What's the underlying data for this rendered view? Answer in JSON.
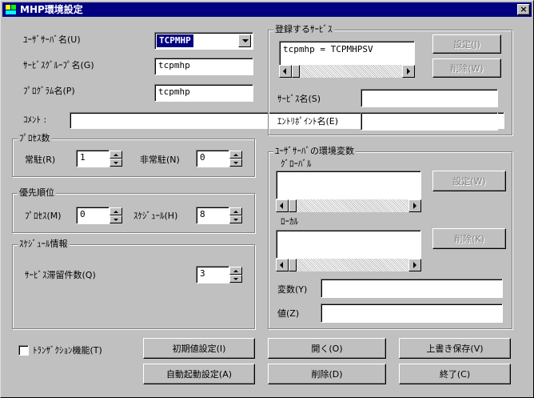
{
  "window": {
    "title": "MHP環境設定",
    "close_glyph": "×"
  },
  "left": {
    "user_server_name_label": "ﾕｰｻﾞｻｰﾊﾞ名(U)",
    "user_server_name_value": "TCPMHP",
    "service_group_name_label": "ｻｰﾋﾞｽｸﾞﾙｰﾌﾟ名(G)",
    "service_group_name_value": "tcpmhp",
    "program_name_label": "ﾌﾟﾛｸﾞﾗﾑ名(P)",
    "program_name_value": "tcpmhp",
    "comment_label": "ｺﾒﾝﾄ :",
    "comment_value": ""
  },
  "process_group": {
    "title": "ﾌﾟﾛｾｽ数",
    "resident_label": "常駐(R)",
    "resident_value": "1",
    "nonresident_label": "非常駐(N)",
    "nonresident_value": "0"
  },
  "priority_group": {
    "title": "優先順位",
    "process_label": "ﾌﾟﾛｾｽ(M)",
    "process_value": "0",
    "schedule_label": "ｽｹｼﾞｭｰﾙ(H)",
    "schedule_value": "8"
  },
  "schedule_group": {
    "title": "ｽｹｼﾞｭｰﾙ情報",
    "backlog_label": "ｻｰﾋﾞｽ滞留件数(Q)",
    "backlog_value": "3"
  },
  "service_group": {
    "title": "登録するｻｰﾋﾞｽ",
    "list_items": [
      "tcpmhp = TCPMHPSV"
    ],
    "set_button": "設定(J)",
    "delete_button": "削除(W)",
    "service_name_label": "ｻｰﾋﾞｽ名(S)",
    "service_name_value": "",
    "entry_point_label": "ｴﾝﾄﾘﾎﾟｲﾝﾄ名(E)",
    "entry_point_value": ""
  },
  "env_group": {
    "title": "ﾕｰｻﾞｻｰﾊﾞの環境変数",
    "global_label": "ｸﾞﾛｰﾊﾞﾙ",
    "local_label": "ﾛｰｶﾙ",
    "set_button": "設定(W)",
    "delete_button": "削除(K)",
    "variable_label": "変数(Y)",
    "variable_value": "",
    "value_label": "値(Z)",
    "value_value": ""
  },
  "bottom": {
    "transaction_label": "ﾄﾗﾝｻﾞｸｼｮﾝ機能(T)",
    "initial_button": "初期値設定(I)",
    "open_button": "開く(O)",
    "overwrite_button": "上書き保存(V)",
    "autostart_button": "自動起動設定(A)",
    "delete_button": "削除(D)",
    "exit_button": "終了(C)"
  }
}
